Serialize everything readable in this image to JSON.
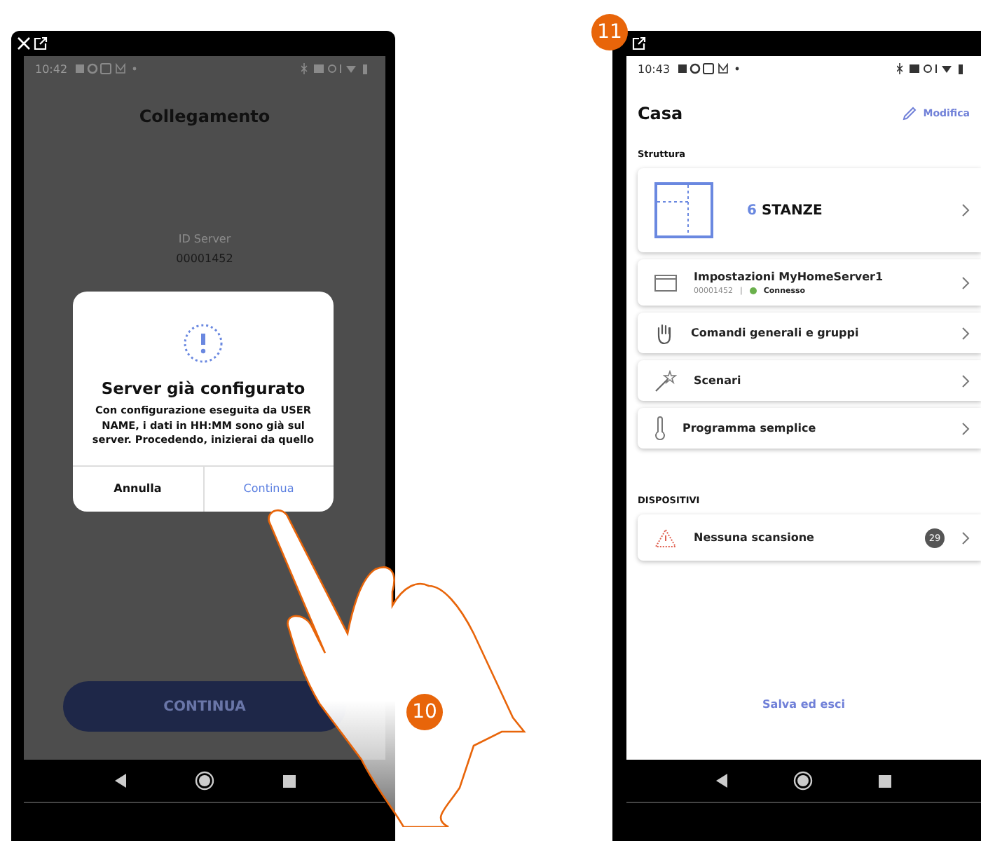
{
  "steps": [
    "10",
    "11"
  ],
  "left_screen": {
    "status_time": "10:42",
    "title": "Collegamento",
    "id_label": "ID Server",
    "id_value": "00001452",
    "background_button": "CONTINUA",
    "dialog": {
      "title": "Server già configurato",
      "message": "Con configurazione eseguita da USER NAME, i dati in HH:MM sono già sul server. Procedendo, inizierai da quello",
      "buttons": [
        {
          "label": "Annulla",
          "kind": "cancel",
          "selected": false
        },
        {
          "label": "Continua",
          "kind": "confirm",
          "selected": true
        }
      ]
    }
  },
  "right_screen": {
    "status_time": "10:43",
    "title": "Casa",
    "edit": "Modifica",
    "section": "Struttura",
    "rooms": {
      "count": "6",
      "label": "STANZE"
    },
    "items": [
      {
        "kind": "server",
        "label": "Impostazioni MyHomeServer1",
        "id": "00001452",
        "separator": "|",
        "status": "Connesso",
        "color": "#6ab04c"
      },
      {
        "kind": "commands",
        "label": "Comandi generali e gruppi"
      },
      {
        "kind": "scenarios",
        "label": "Scenari"
      },
      {
        "kind": "program",
        "label": "Programma semplice"
      }
    ],
    "devices_section": "DISPOSITIVI",
    "devices": {
      "label": "Nessuna scansione",
      "count": "29"
    },
    "footer": "Salva ed esci"
  }
}
